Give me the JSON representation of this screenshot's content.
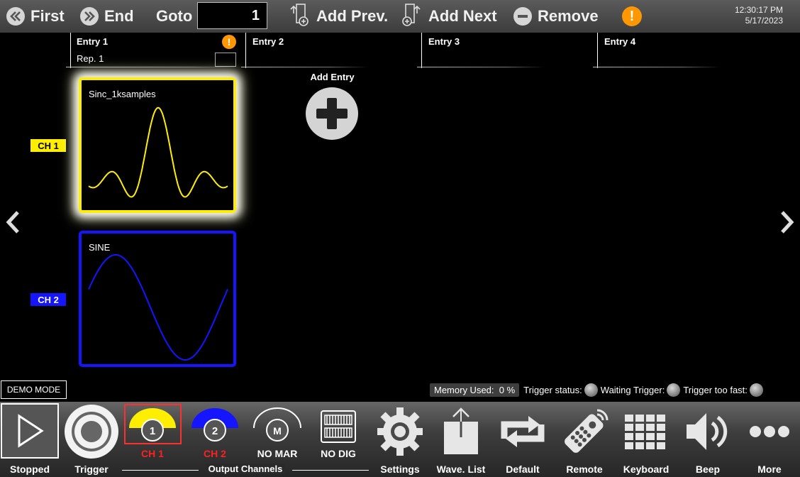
{
  "toolbar": {
    "first_label": "First",
    "end_label": "End",
    "goto_label": "Goto",
    "goto_value": "1",
    "add_prev_label": "Add Prev.",
    "add_next_label": "Add Next",
    "remove_label": "Remove",
    "warning_glyph": "!",
    "time": "12:30:17 PM",
    "date": "5/17/2023"
  },
  "entries": [
    {
      "label": "Entry  1",
      "rep_label": "Rep.  1"
    },
    {
      "label": "Entry  2"
    },
    {
      "label": "Entry  3"
    },
    {
      "label": "Entry  4"
    }
  ],
  "add_entry_label": "Add Entry",
  "channels": [
    {
      "tag": "CH 1",
      "waveform": "Sinc_1ksamples",
      "color": "#ffee00"
    },
    {
      "tag": "CH 2",
      "waveform": "SINE",
      "color": "#1515ff"
    }
  ],
  "status": {
    "demo_mode": "DEMO MODE",
    "memory_label": "Memory Used:",
    "memory_value": "0 %",
    "trigger_status": "Trigger status:",
    "waiting_trigger": "Waiting Trigger:",
    "trigger_too_fast": "Trigger too fast:"
  },
  "bottom": {
    "stopped": "Stopped",
    "trigger": "Trigger",
    "ch1_label": "CH 1",
    "ch1_num": "1",
    "ch2_label": "CH 2",
    "ch2_num": "2",
    "marker_label": "NO MAR",
    "marker_glyph": "M",
    "digital_label": "NO DIG",
    "output_channels": "Output Channels",
    "settings": "Settings",
    "wave_list": "Wave. List",
    "default": "Default",
    "remote": "Remote",
    "keyboard": "Keyboard",
    "beep": "Beep",
    "more": "More"
  },
  "colors": {
    "ch1": "#ffee00",
    "ch2": "#1515ff",
    "warning": "#ff9800",
    "ch_active_label": "#ff2020",
    "selected_frame": "#ff3030"
  }
}
